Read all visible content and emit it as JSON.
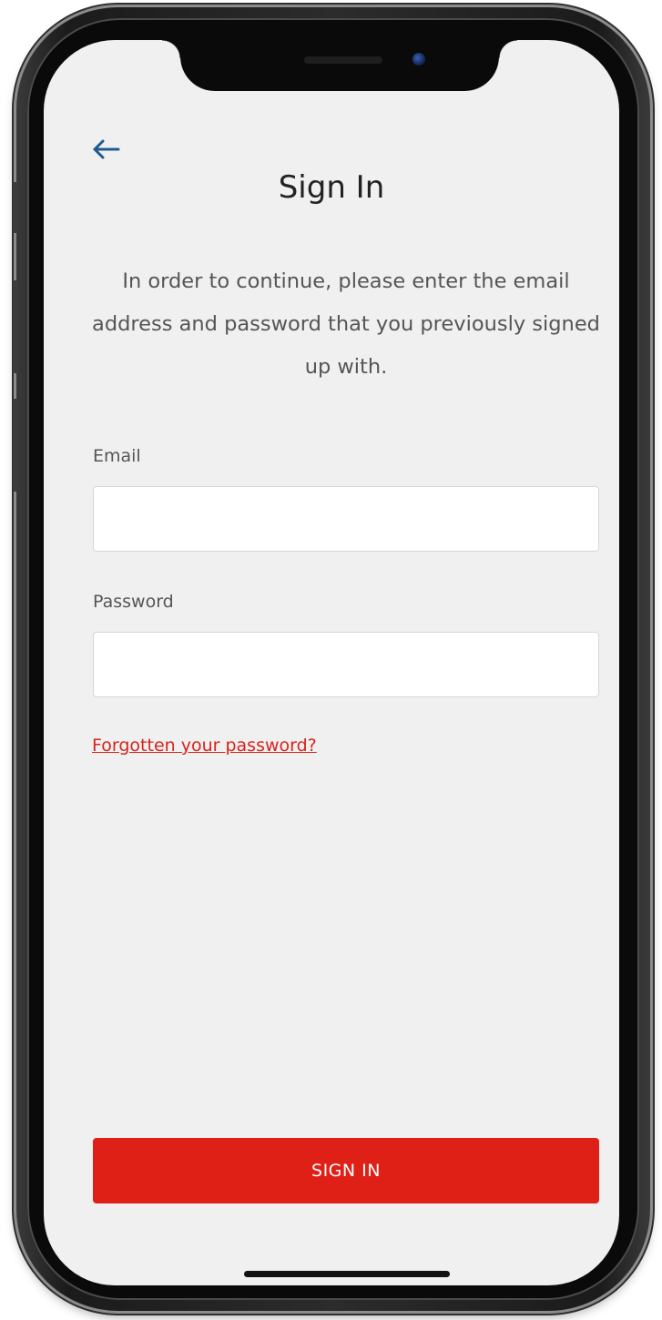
{
  "app": {
    "screen_title": "Sign In",
    "instructions": "In order to continue, please enter the email address and password that you previously signed up with."
  },
  "icons": {
    "back": "back-arrow-icon"
  },
  "form": {
    "email_label": "Email",
    "email_value": "",
    "password_label": "Password",
    "password_value": "",
    "forgot_password_link": "Forgotten your password?",
    "submit_label": "SIGN IN"
  },
  "colors": {
    "accent": "#df2016",
    "back_arrow": "#1f5b8f",
    "background": "#f0f0f0"
  }
}
